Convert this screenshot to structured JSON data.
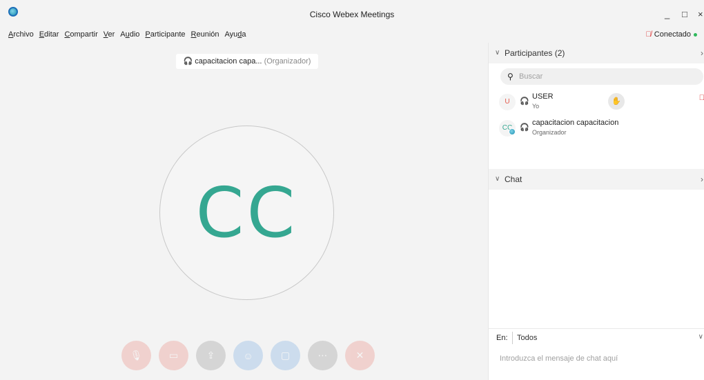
{
  "window": {
    "title": "Cisco Webex Meetings",
    "minimize": "_",
    "maximize": "□",
    "close": "×"
  },
  "menu": [
    {
      "underline": "A",
      "rest": "rchivo"
    },
    {
      "underline": "E",
      "rest": "ditar"
    },
    {
      "underline": "C",
      "rest": "ompartir"
    },
    {
      "underline": "V",
      "rest": "er"
    },
    {
      "pre": "A",
      "underline": "u",
      "rest": "dio"
    },
    {
      "underline": "P",
      "rest": "articipante"
    },
    {
      "underline": "R",
      "rest": "eunión"
    },
    {
      "pre": "Ayu",
      "underline": "d",
      "rest": "a"
    }
  ],
  "status": {
    "connection": "Conectado",
    "status_color": "#2eb85c"
  },
  "stage": {
    "presenter_name": "capacitacion capa...",
    "presenter_role": "(Organizador)",
    "avatar_initials": "CC",
    "avatar_color": "#35a791"
  },
  "controls": [
    {
      "icon": "microphone-icon",
      "glyph": "🎙",
      "style": "red"
    },
    {
      "icon": "video-icon",
      "glyph": "▭",
      "style": "red"
    },
    {
      "icon": "share-icon",
      "glyph": "⇪",
      "style": "gray"
    },
    {
      "icon": "participants-icon",
      "glyph": "☺",
      "style": "blue"
    },
    {
      "icon": "chat-icon",
      "glyph": "▢",
      "style": "blue"
    },
    {
      "icon": "more-icon",
      "glyph": "⋯",
      "style": "gray"
    },
    {
      "icon": "leave-icon",
      "glyph": "✕",
      "style": "red"
    }
  ],
  "participants_panel": {
    "title": "Participantes (2)",
    "search_placeholder": "Buscar",
    "people": [
      {
        "initials": "U",
        "name": "USER",
        "role": "Yo",
        "has_hand": true,
        "muted": true
      },
      {
        "initials": "CC",
        "name": "capacitacion capacitacion",
        "role": "Organizador",
        "has_hand": false,
        "muted": false
      }
    ]
  },
  "chat_panel": {
    "title": "Chat",
    "to_label": "En:",
    "to_value": "Todos",
    "message_placeholder": "Introduzca el mensaje de chat aquí"
  }
}
